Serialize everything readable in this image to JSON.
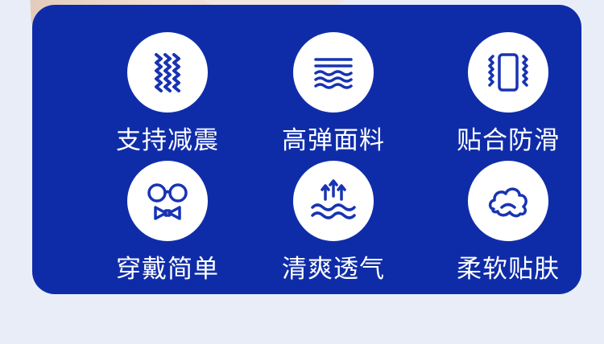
{
  "colors": {
    "panel": "#0f2ca8",
    "icon": "#1833b3",
    "background": "#e9edf8"
  },
  "features": [
    {
      "label": "支持减震",
      "icon": "wave-lines-icon"
    },
    {
      "label": "高弹面料",
      "icon": "fabric-layers-icon"
    },
    {
      "label": "贴合防滑",
      "icon": "non-slip-pad-icon"
    },
    {
      "label": "穿戴简单",
      "icon": "glasses-bowtie-icon"
    },
    {
      "label": "清爽透气",
      "icon": "breathable-air-icon"
    },
    {
      "label": "柔软贴肤",
      "icon": "soft-cloud-icon"
    }
  ]
}
